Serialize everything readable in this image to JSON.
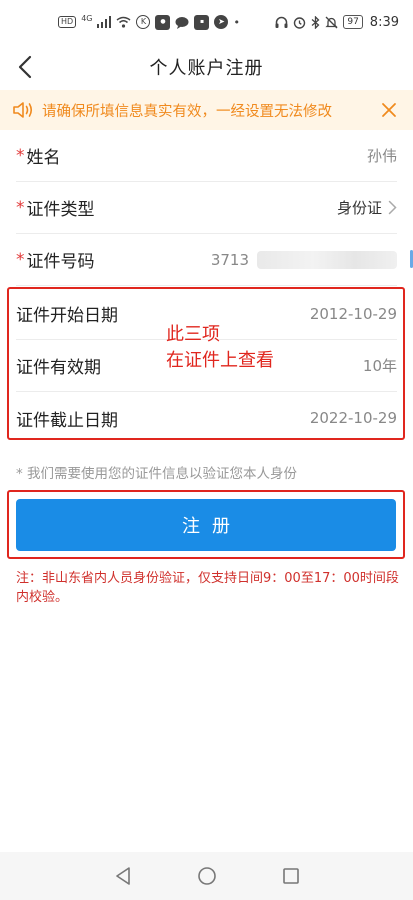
{
  "status_bar": {
    "time": "8:39",
    "battery": "97",
    "hd": "HD",
    "network": "4G"
  },
  "nav": {
    "title": "个人账户注册"
  },
  "notice": {
    "text": "请确保所填信息真实有效，一经设置无法修改"
  },
  "form": {
    "name": {
      "label": "姓名",
      "value": "孙伟",
      "required": "*"
    },
    "id_type": {
      "label": "证件类型",
      "value": "身份证",
      "required": "*"
    },
    "id_number": {
      "label": "证件号码",
      "value": "3713",
      "required": "*"
    },
    "start_date": {
      "label": "证件开始日期",
      "value": "2012-10-29"
    },
    "validity": {
      "label": "证件有效期",
      "value": "10年"
    },
    "end_date": {
      "label": "证件截止日期",
      "value": "2022-10-29"
    }
  },
  "annotation": {
    "line1": "此三项",
    "line2": "在证件上查看"
  },
  "hint": "* 我们需要使用您的证件信息以验证您本人身份",
  "register_button": "注册",
  "footnote": "注：非山东省内人员身份验证，仅支持日间9：00至17：00时间段内校验。",
  "colors": {
    "accent": "#1a8ce6",
    "notice_bg": "#fff5e6",
    "notice_text": "#f08a1e",
    "annotation": "#e0261e"
  }
}
